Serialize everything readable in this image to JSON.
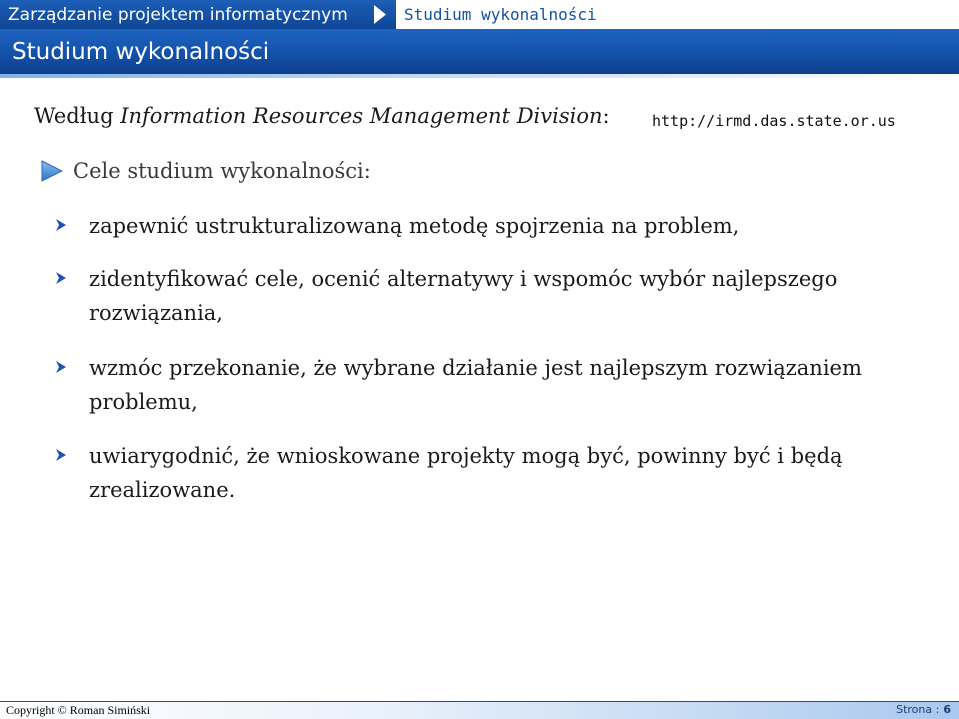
{
  "header": {
    "course_title": "Zarządzanie projektem informatycznym",
    "breadcrumb_current": "Studium wykonalności",
    "page_title": "Studium wykonalności"
  },
  "source": {
    "prefix": "Według ",
    "organization": "Information Resources Management Division",
    "suffix": ":",
    "url": "http://irmd.das.state.or.us"
  },
  "section": {
    "heading": "Cele studium wykonalności:"
  },
  "bullets": [
    {
      "text": "zapewnić ustrukturalizowaną metodę spojrzenia na problem,"
    },
    {
      "text": "zidentyfikować cele, ocenić alternatywy i wspomóc wybór najlepszego rozwiązania,"
    },
    {
      "text": "wzmóc przekonanie, że wybrane działanie jest najlepszym rozwiązaniem problemu,"
    },
    {
      "text": "uwiarygodnić, że wnioskowane projekty mogą być, powinny być i będą zrealizowane."
    }
  ],
  "footer": {
    "copyright": "Copyright © Roman Simiński",
    "page_label": "Strona :",
    "page_number": "6"
  },
  "colors": {
    "header_blue": "#124fa6",
    "text_blue": "#1452a8",
    "bullet_blue": "#1a56b0",
    "arrow_blue": "#4a90d9"
  }
}
